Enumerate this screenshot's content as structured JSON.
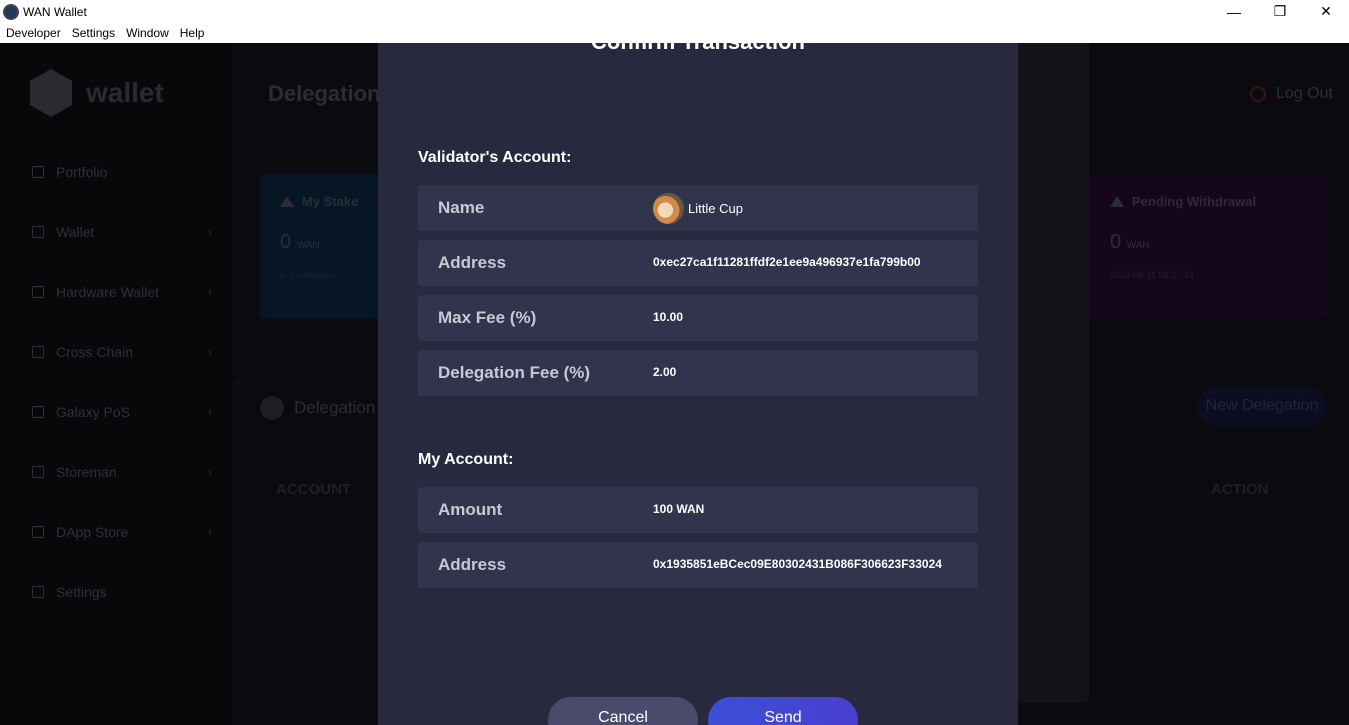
{
  "window": {
    "title": "WAN Wallet",
    "minimize": "—",
    "restore": "❐",
    "close": "✕"
  },
  "menu": [
    "Developer",
    "Settings",
    "Window",
    "Help"
  ],
  "background": {
    "logo_text": "wallet",
    "page_title": "Delegation",
    "logout": "Log Out",
    "nav": [
      "Portfolio",
      "Wallet",
      "Hardware Wallet",
      "Cross Chain",
      "Galaxy PoS",
      "Storeman",
      "DApp Store",
      "Settings"
    ],
    "card_left": {
      "label": "My Stake",
      "value": "0",
      "unit": "WAN",
      "sub": "in 0 validators"
    },
    "card_right": {
      "label": "Pending Withdrawal",
      "value": "0",
      "unit": "WAN",
      "sub": "2022-08-31 04:37:34"
    },
    "delegation_heading": "Delegation L",
    "new_delegation": "New Delegation",
    "col_account": "ACCOUNT",
    "col_action": "ACTION"
  },
  "modal": {
    "title": "Confirm Transaction",
    "validator_section": "Validator's Account:",
    "validator": {
      "name_label": "Name",
      "name_value": "Little Cup",
      "address_label": "Address",
      "address_value": "0xec27ca1f11281ffdf2e1ee9a496937e1fa799b00",
      "maxfee_label": "Max Fee (%)",
      "maxfee_value": "10.00",
      "delegfee_label": "Delegation Fee (%)",
      "delegfee_value": "2.00"
    },
    "my_section": "My Account:",
    "my": {
      "amount_label": "Amount",
      "amount_value": "100 WAN",
      "address_label": "Address",
      "address_value": "0x1935851eBCec09E80302431B086F306623F33024"
    },
    "cancel": "Cancel",
    "send": "Send"
  }
}
